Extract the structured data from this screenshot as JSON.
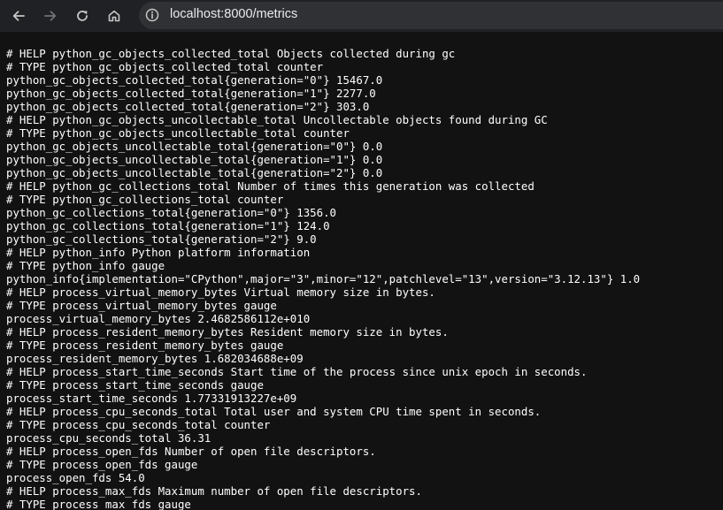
{
  "browser": {
    "url": "localhost:8000/metrics",
    "icons": {
      "back": "arrow-left-icon",
      "forward": "arrow-right-icon",
      "reload": "reload-icon",
      "home": "home-icon",
      "site_info": "info-icon"
    }
  },
  "page": {
    "lines": [
      "# HELP python_gc_objects_collected_total Objects collected during gc",
      "# TYPE python_gc_objects_collected_total counter",
      "python_gc_objects_collected_total{generation=\"0\"} 15467.0",
      "python_gc_objects_collected_total{generation=\"1\"} 2277.0",
      "python_gc_objects_collected_total{generation=\"2\"} 303.0",
      "# HELP python_gc_objects_uncollectable_total Uncollectable objects found during GC",
      "# TYPE python_gc_objects_uncollectable_total counter",
      "python_gc_objects_uncollectable_total{generation=\"0\"} 0.0",
      "python_gc_objects_uncollectable_total{generation=\"1\"} 0.0",
      "python_gc_objects_uncollectable_total{generation=\"2\"} 0.0",
      "# HELP python_gc_collections_total Number of times this generation was collected",
      "# TYPE python_gc_collections_total counter",
      "python_gc_collections_total{generation=\"0\"} 1356.0",
      "python_gc_collections_total{generation=\"1\"} 124.0",
      "python_gc_collections_total{generation=\"2\"} 9.0",
      "# HELP python_info Python platform information",
      "# TYPE python_info gauge",
      "python_info{implementation=\"CPython\",major=\"3\",minor=\"12\",patchlevel=\"13\",version=\"3.12.13\"} 1.0",
      "# HELP process_virtual_memory_bytes Virtual memory size in bytes.",
      "# TYPE process_virtual_memory_bytes gauge",
      "process_virtual_memory_bytes 2.4682586112e+010",
      "# HELP process_resident_memory_bytes Resident memory size in bytes.",
      "# TYPE process_resident_memory_bytes gauge",
      "process_resident_memory_bytes 1.682034688e+09",
      "# HELP process_start_time_seconds Start time of the process since unix epoch in seconds.",
      "# TYPE process_start_time_seconds gauge",
      "process_start_time_seconds 1.77331913227e+09",
      "# HELP process_cpu_seconds_total Total user and system CPU time spent in seconds.",
      "# TYPE process_cpu_seconds_total counter",
      "process_cpu_seconds_total 36.31",
      "# HELP process_open_fds Number of open file descriptors.",
      "# TYPE process_open_fds gauge",
      "process_open_fds 54.0",
      "# HELP process_max_fds Maximum number of open file descriptors.",
      "# TYPE process_max_fds gauge"
    ]
  }
}
